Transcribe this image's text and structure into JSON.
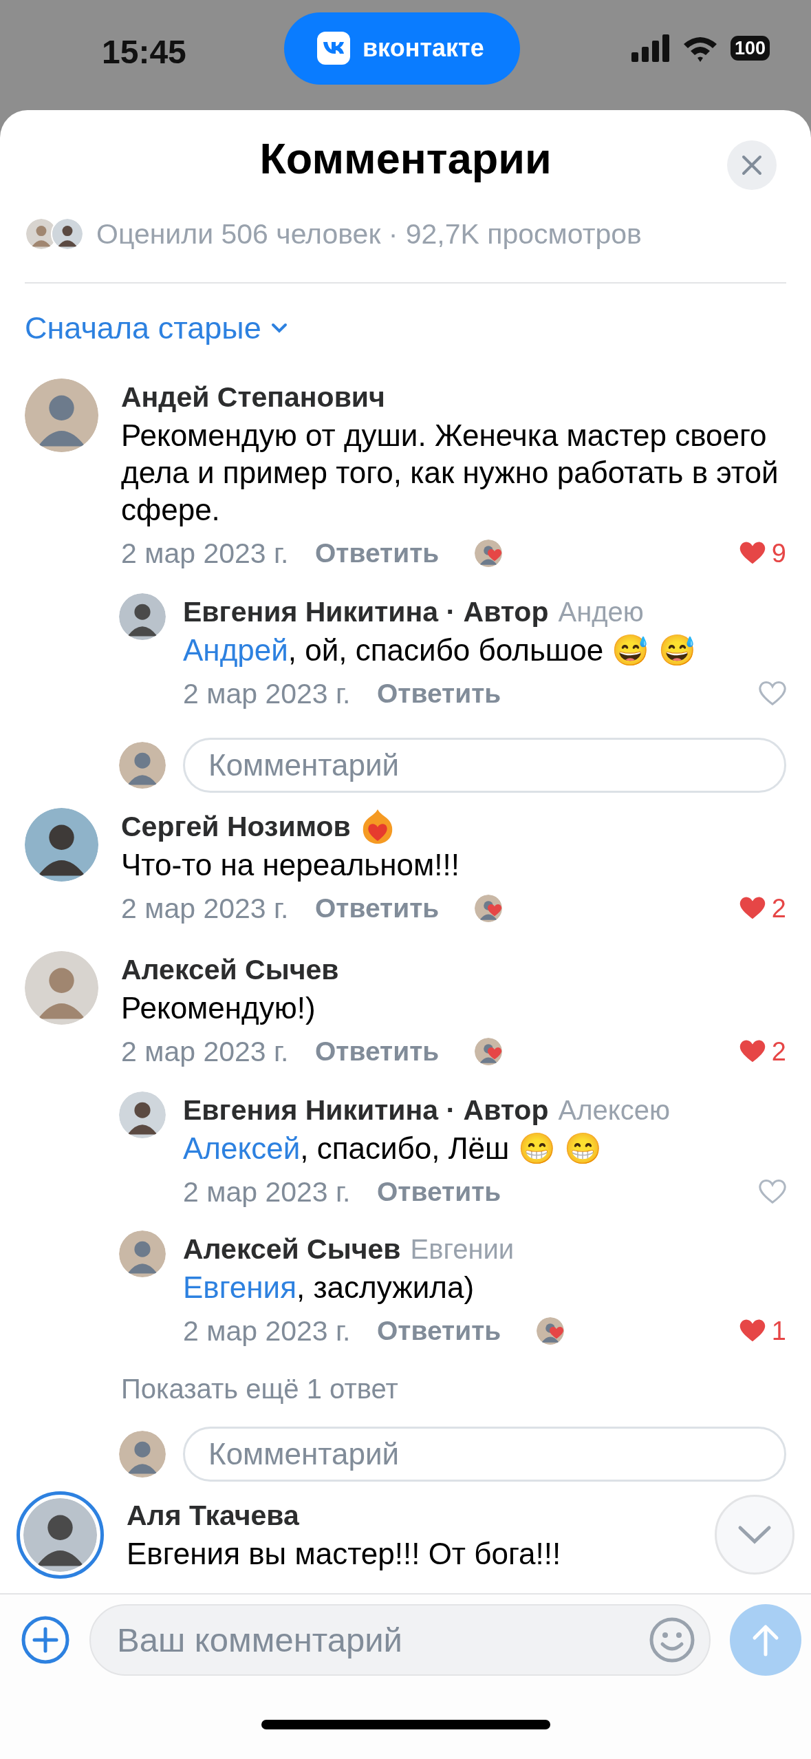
{
  "status_bar": {
    "time": "15:45",
    "app_pill": "вконтакте",
    "battery": "100"
  },
  "header": {
    "title": "Комментарии"
  },
  "stats": {
    "text": "Оценили 506 человек · 92,7K просмотров"
  },
  "sort": {
    "label": "Сначала старые"
  },
  "comments": [
    {
      "author": "Андей Степанович",
      "has_badge": false,
      "story_ring": false,
      "text": "Рекомендую от души. Женечка мастер своего дела и пример того, как нужно работать в этой сфере.",
      "date": "2 мар 2023 г.",
      "reply_label": "Ответить",
      "liker_avatar": true,
      "liked": true,
      "likes": "9",
      "children": [
        {
          "author": "Евгения Никитина · Автор",
          "reply_to": "Андею",
          "mention": "Андрей",
          "text": ", ой, спасибо большое 😅 😅",
          "date": "2 мар 2023 г.",
          "reply_label": "Ответить",
          "liker_avatar": false,
          "liked": false
        }
      ],
      "reply_field": {
        "placeholder": "Комментарий"
      }
    },
    {
      "author": "Сергей Нозимов",
      "has_badge": true,
      "story_ring": false,
      "text": "Что-то на нереальном!!!",
      "date": "2 мар 2023 г.",
      "reply_label": "Ответить",
      "liker_avatar": true,
      "liked": true,
      "likes": "2"
    },
    {
      "author": "Алексей Сычев",
      "has_badge": false,
      "story_ring": false,
      "text": "Рекомендую!)",
      "date": "2 мар 2023 г.",
      "reply_label": "Ответить",
      "liker_avatar": true,
      "liked": true,
      "likes": "2",
      "children": [
        {
          "author": "Евгения Никитина · Автор",
          "reply_to": "Алексею",
          "mention": "Алексей",
          "text": ", спасибо, Лёш  😁 😁",
          "date": "2 мар 2023 г.",
          "reply_label": "Ответить",
          "liker_avatar": false,
          "liked": false
        },
        {
          "author": "Алексей Сычев",
          "reply_to": "Евгении",
          "mention": "Евгения",
          "text": ", заслужила)",
          "date": "2 мар 2023 г.",
          "reply_label": "Ответить",
          "liker_avatar": true,
          "liked": true,
          "likes": "1"
        }
      ],
      "more_replies": "Показать ещё 1 ответ",
      "reply_field": {
        "placeholder": "Комментарий"
      }
    },
    {
      "author": "Аля Ткачева",
      "has_badge": false,
      "story_ring": true,
      "text": "Евгения вы мастер!!! От бога!!!"
    }
  ],
  "composer": {
    "placeholder": "Ваш комментарий"
  }
}
